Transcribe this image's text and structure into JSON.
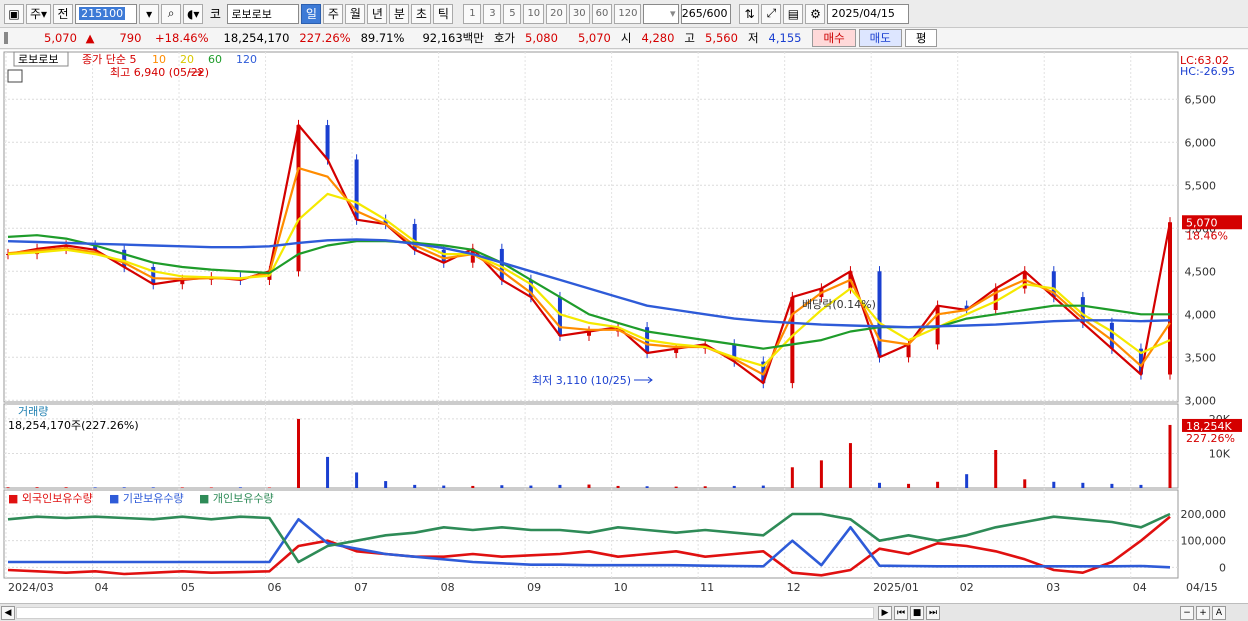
{
  "toolbar": {
    "type_label": "주",
    "prev_label": "전",
    "code": "215100",
    "market_label": "코",
    "stock_name": "로보로보",
    "periods": [
      "일",
      "주",
      "월",
      "년",
      "분",
      "초",
      "틱"
    ],
    "active_period": "일",
    "numbers": [
      "1",
      "3",
      "5",
      "10",
      "20",
      "30",
      "60",
      "120"
    ],
    "count": "265/600",
    "date": "2025/04/15"
  },
  "quote": {
    "price": "5,070",
    "change": "790",
    "change_pct": "+18.46%",
    "volume": "18,254,170",
    "vol_ratio": "227.26%",
    "turnover": "89.71%",
    "amount": "92,163백만",
    "ask_label": "호가",
    "ask1": "5,080",
    "ask2": "5,070",
    "open_label": "시",
    "open": "4,280",
    "high_label": "고",
    "high": "5,560",
    "low_label": "저",
    "low": "4,155",
    "buy_label": "매수",
    "sell_label": "매도",
    "eval_label": "평"
  },
  "colors": {
    "ma5": "#d40000",
    "ma10": "#ff8c00",
    "ma20": "#f5e900",
    "ma60": "#1e9c2a",
    "ma120": "#2e5bd8",
    "candle_up": "#d40000",
    "candle_down": "#1a3fd0"
  },
  "chart_data": [
    {
      "type": "line",
      "title": "로보로보",
      "legend": [
        "종가 단순 5",
        "10",
        "20",
        "60",
        "120"
      ],
      "x_ticks": [
        "2024/03",
        "04",
        "05",
        "06",
        "07",
        "08",
        "09",
        "10",
        "11",
        "12",
        "2025/01",
        "02",
        "03",
        "04",
        "04/15"
      ],
      "yticks": [
        3000,
        3500,
        4000,
        4500,
        5000,
        5500,
        6000,
        6500
      ],
      "ylim": [
        2980,
        6980
      ],
      "lc": "LC:63.02",
      "hc": "HC:-26.95",
      "last_price": "5,070",
      "last_pct": "18.46%",
      "high_annotation": "최고 6,940 (05/22)",
      "low_annotation": "최저 3,110 (10/25)",
      "dividend_annotation": "배당락(0.14%)",
      "series": [
        {
          "name": "5",
          "values": [
            4700,
            4760,
            4800,
            4750,
            4550,
            4350,
            4400,
            4430,
            4400,
            4500,
            6200,
            5800,
            5100,
            5050,
            4750,
            4600,
            4760,
            4400,
            4200,
            3750,
            3800,
            3850,
            3550,
            3600,
            3650,
            3450,
            3200,
            4200,
            4300,
            4500,
            3500,
            3650,
            4100,
            4050,
            4300,
            4500,
            4200,
            3900,
            3600,
            3300,
            5070
          ]
        },
        {
          "name": "10",
          "values": [
            4710,
            4740,
            4770,
            4720,
            4600,
            4420,
            4410,
            4420,
            4410,
            4480,
            5700,
            5600,
            5200,
            5050,
            4800,
            4650,
            4700,
            4500,
            4250,
            3850,
            3820,
            3820,
            3650,
            3620,
            3620,
            3480,
            3300,
            4000,
            4250,
            4400,
            3700,
            3650,
            4000,
            4050,
            4250,
            4400,
            4250,
            3950,
            3700,
            3400,
            3900
          ]
        },
        {
          "name": "20",
          "values": [
            4700,
            4720,
            4750,
            4700,
            4620,
            4500,
            4440,
            4430,
            4420,
            4450,
            5100,
            5400,
            5300,
            5100,
            4850,
            4700,
            4700,
            4550,
            4350,
            4000,
            3900,
            3850,
            3700,
            3650,
            3620,
            3500,
            3400,
            3750,
            4050,
            4300,
            3900,
            3700,
            3850,
            4000,
            4150,
            4350,
            4300,
            4000,
            3800,
            3550,
            3700
          ]
        },
        {
          "name": "60",
          "values": [
            4900,
            4920,
            4880,
            4800,
            4700,
            4600,
            4550,
            4520,
            4500,
            4480,
            4700,
            4800,
            4850,
            4850,
            4830,
            4800,
            4750,
            4600,
            4400,
            4200,
            4000,
            3900,
            3800,
            3750,
            3700,
            3650,
            3600,
            3650,
            3700,
            3800,
            3850,
            3850,
            3850,
            3950,
            4000,
            4050,
            4100,
            4100,
            4050,
            4000,
            4000
          ]
        },
        {
          "name": "120",
          "values": [
            4850,
            4840,
            4830,
            4820,
            4810,
            4800,
            4790,
            4780,
            4780,
            4790,
            4830,
            4860,
            4870,
            4860,
            4820,
            4770,
            4700,
            4600,
            4500,
            4400,
            4300,
            4200,
            4100,
            4050,
            4000,
            3950,
            3920,
            3900,
            3880,
            3870,
            3860,
            3850,
            3860,
            3870,
            3880,
            3900,
            3920,
            3930,
            3930,
            3920,
            3930
          ]
        }
      ]
    },
    {
      "type": "bar",
      "title": "거래량",
      "subtitle": "18,254,170주(227.26%)",
      "yticks": [
        10000,
        20000
      ],
      "ylim": [
        0,
        22000
      ],
      "unit": "K",
      "last": "18,254K",
      "last_pct": "227.26%",
      "values": [
        200,
        220,
        210,
        180,
        200,
        190,
        170,
        160,
        200,
        150,
        20000,
        9000,
        4500,
        2000,
        900,
        700,
        600,
        800,
        700,
        900,
        1000,
        600,
        500,
        400,
        500,
        600,
        700,
        6000,
        8000,
        13000,
        1500,
        1200,
        1800,
        4000,
        11000,
        2500,
        1800,
        1500,
        1200,
        900,
        18254
      ]
    },
    {
      "type": "line",
      "title": "외국인보유수량 / 기관보유수량 / 개인보유수량",
      "legend": [
        "외국인보유수량",
        "기관보유수량",
        "개인보유수량"
      ],
      "yticks": [
        0,
        100000,
        200000
      ],
      "ylim": [
        -40000,
        260000
      ],
      "series": [
        {
          "name": "외국인보유수량",
          "values": [
            -10000,
            -15000,
            -20000,
            -15000,
            -25000,
            -20000,
            -15000,
            -20000,
            -18000,
            -15000,
            80000,
            100000,
            60000,
            50000,
            40000,
            40000,
            50000,
            40000,
            45000,
            50000,
            60000,
            40000,
            50000,
            60000,
            40000,
            50000,
            60000,
            -20000,
            -30000,
            -10000,
            70000,
            50000,
            90000,
            80000,
            60000,
            30000,
            -10000,
            -20000,
            20000,
            100000,
            190000
          ]
        },
        {
          "name": "기관보유수량",
          "values": [
            20000,
            20000,
            20000,
            20000,
            20000,
            20000,
            20000,
            20000,
            20000,
            20000,
            180000,
            90000,
            70000,
            50000,
            40000,
            30000,
            20000,
            15000,
            10000,
            10000,
            8000,
            8000,
            8000,
            8000,
            6000,
            5000,
            4000,
            100000,
            8000,
            150000,
            6000,
            5000,
            4000,
            4000,
            4000,
            4000,
            4000,
            4000,
            4000,
            5000,
            0
          ]
        },
        {
          "name": "개인보유수량",
          "values": [
            180000,
            190000,
            185000,
            190000,
            185000,
            180000,
            190000,
            180000,
            190000,
            185000,
            20000,
            80000,
            100000,
            120000,
            130000,
            150000,
            140000,
            150000,
            140000,
            140000,
            130000,
            150000,
            140000,
            130000,
            140000,
            130000,
            120000,
            200000,
            200000,
            180000,
            100000,
            120000,
            100000,
            120000,
            150000,
            170000,
            190000,
            180000,
            170000,
            150000,
            200000
          ]
        }
      ]
    }
  ]
}
